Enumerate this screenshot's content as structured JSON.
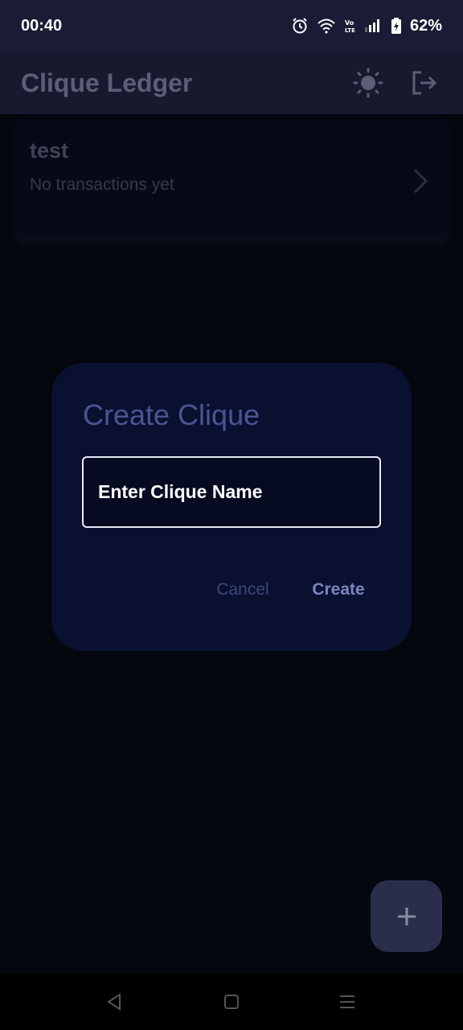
{
  "status_bar": {
    "time": "00:40",
    "battery_percent": "62%",
    "icons": [
      "alarm-icon",
      "wifi-icon",
      "volte-icon",
      "signal-icon",
      "battery-charging-icon"
    ]
  },
  "app_bar": {
    "title": "Clique Ledger",
    "actions": [
      "sun-icon",
      "logout-icon"
    ]
  },
  "clique_list": [
    {
      "name": "test",
      "subtitle": "No transactions yet"
    }
  ],
  "dialog": {
    "title": "Create Clique",
    "input_placeholder": "Enter Clique Name",
    "input_value": "",
    "cancel_label": "Cancel",
    "create_label": "Create"
  },
  "fab": {
    "icon": "plus-icon"
  },
  "nav_bar": {
    "icons": [
      "back-icon",
      "home-icon",
      "recents-icon"
    ]
  },
  "colors": {
    "background": "#05070f",
    "app_bar": "#17192f",
    "dialog": "#0a1030",
    "accent": "#7c86bd",
    "fab": "#2a2e4b"
  }
}
